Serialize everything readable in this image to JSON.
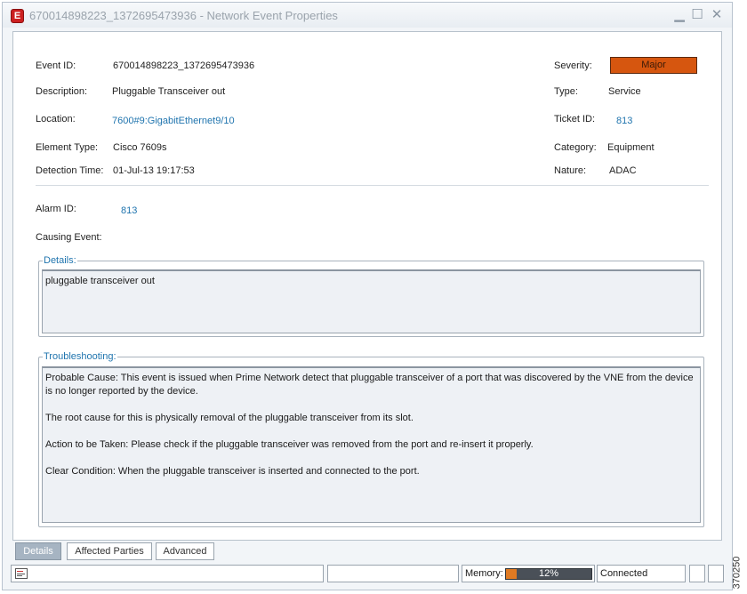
{
  "window": {
    "title": "670014898223_1372695473936 - Network Event Properties",
    "app_icon_letter": "E",
    "controls": {
      "minimize": "▁",
      "maximize": "☐",
      "close": "✕"
    }
  },
  "fields": {
    "event_id": {
      "label": "Event ID:",
      "value": "670014898223_1372695473936"
    },
    "description": {
      "label": "Description:",
      "value": "Pluggable Transceiver out"
    },
    "location": {
      "label": "Location:",
      "value": "7600#9:GigabitEthernet9/10"
    },
    "element_type": {
      "label": "Element Type:",
      "value": "Cisco 7609s"
    },
    "detection_time": {
      "label": "Detection Time:",
      "value": "01-Jul-13 19:17:53"
    },
    "severity": {
      "label": "Severity:",
      "value": "Major",
      "color": "#d6560f"
    },
    "type": {
      "label": "Type:",
      "value": "Service"
    },
    "ticket_id": {
      "label": "Ticket ID:",
      "value": "813"
    },
    "category": {
      "label": "Category:",
      "value": "Equipment"
    },
    "nature": {
      "label": "Nature:",
      "value": "ADAC"
    },
    "alarm_id": {
      "label": "Alarm ID:",
      "value": "813"
    },
    "causing_event": {
      "label": "Causing Event:",
      "value": ""
    }
  },
  "details": {
    "legend": "Details:",
    "text": "pluggable transceiver out"
  },
  "troubleshooting": {
    "legend": "Troubleshooting:",
    "paragraphs": [
      "Probable Cause: This event is issued when Prime Network detect that pluggable transceiver of a port that was discovered by the VNE from the device is no longer reported by the device.",
      "The root cause for this is physically removal of the pluggable transceiver from its slot.",
      "Action to be Taken: Please check if the pluggable transceiver was removed from the port and re-insert it properly.",
      "Clear Condition: When the pluggable transceiver is inserted and connected to the port."
    ]
  },
  "tabs": [
    {
      "label": "Details",
      "active": true
    },
    {
      "label": "Affected Parties",
      "active": false
    },
    {
      "label": "Advanced",
      "active": false
    }
  ],
  "statusbar": {
    "memory_label": "Memory:",
    "memory_percent": 12,
    "memory_text": "12%",
    "connection": "Connected"
  },
  "figure_id": "370250",
  "colors": {
    "link": "#1f74ae",
    "severity_major": "#d6560f",
    "memory_fill": "#e07a22"
  }
}
